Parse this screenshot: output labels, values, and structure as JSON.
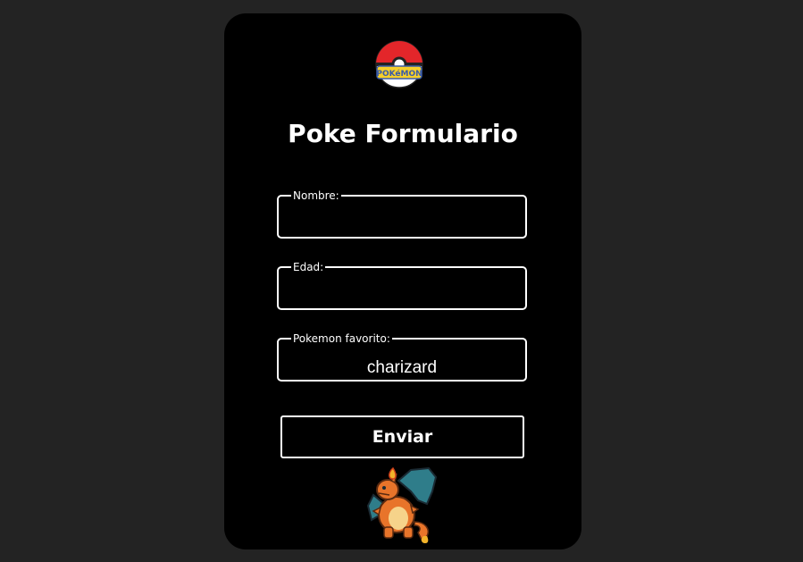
{
  "header": {
    "title": "Poke Formulario",
    "logo_icon": "pokeball-logo-icon",
    "logo_text": "POKéMON"
  },
  "form": {
    "fields": [
      {
        "label": "Nombre:",
        "value": ""
      },
      {
        "label": "Edad:",
        "value": ""
      },
      {
        "label": "Pokemon favorito:",
        "value": "charizard"
      }
    ],
    "submit_label": "Enviar"
  },
  "sprite": {
    "icon": "charizard-sprite-icon"
  },
  "colors": {
    "page_background": "#232323",
    "card_background": "#000000",
    "text": "#ffffff",
    "border": "#ffffff"
  }
}
